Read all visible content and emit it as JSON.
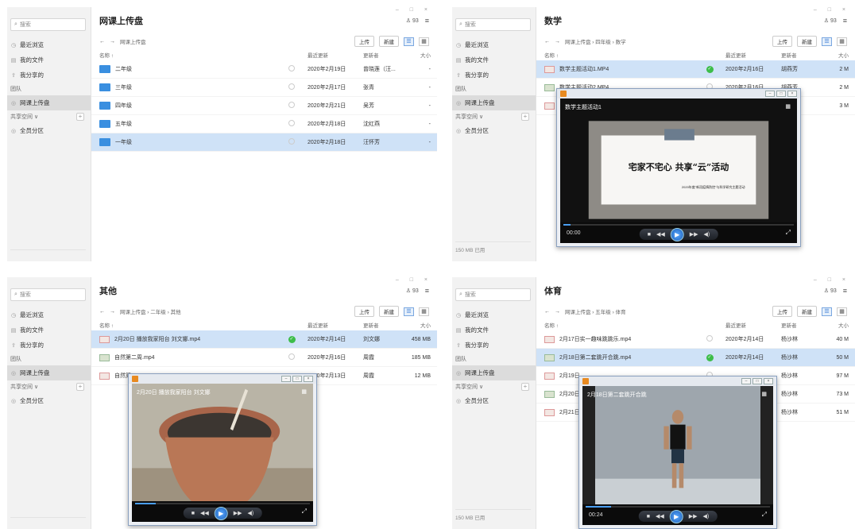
{
  "panels": [
    {
      "sidebar": {
        "search": "搜索",
        "recent": "最近浏览",
        "my_files": "我的文件",
        "my_shared": "我分享的",
        "team_section": "团队",
        "course_upload": "网课上传盘",
        "share_space": "共享空间 ∨",
        "all_staff": "全员分区",
        "quota": ""
      },
      "main": {
        "title": "网课上传盘",
        "user_count": "93",
        "breadcrumb": [
          "网课上传盘"
        ],
        "upload": "上传",
        "new": "新建",
        "columns": {
          "name": "名称 ↑",
          "date": "最近更新",
          "by": "更新者",
          "size": "大小"
        },
        "rows": [
          {
            "name": "二年级",
            "date": "2020年2月19日",
            "by": "曾晓莲（汪...",
            "size": "-",
            "status": "idle",
            "selected": false
          },
          {
            "name": "三年级",
            "date": "2020年2月17日",
            "by": "张青",
            "size": "-",
            "status": "idle",
            "selected": false
          },
          {
            "name": "四年级",
            "date": "2020年2月21日",
            "by": "吴芳",
            "size": "-",
            "status": "idle",
            "selected": false
          },
          {
            "name": "五年级",
            "date": "2020年2月18日",
            "by": "沈红燕",
            "size": "-",
            "status": "idle",
            "selected": false
          },
          {
            "name": "一年级",
            "date": "2020年2月18日",
            "by": "汪怀芳",
            "size": "-",
            "status": "idle",
            "selected": true
          }
        ]
      }
    },
    {
      "sidebar": {
        "search": "搜索",
        "recent": "最近浏览",
        "my_files": "我的文件",
        "my_shared": "我分享的",
        "team_section": "团队",
        "course_upload": "网课上传盘",
        "share_space": "共享空间 ∨",
        "all_staff": "全员分区",
        "quota": "150 MB 已用"
      },
      "main": {
        "title": "数学",
        "user_count": "93",
        "breadcrumb": [
          "网课上传盘",
          "四年级",
          "数学"
        ],
        "upload": "上传",
        "new": "新建",
        "columns": {
          "name": "名称 ↑",
          "date": "最近更新",
          "by": "更新者",
          "size": "大小"
        },
        "rows": [
          {
            "name": "数学主题活动1.MP4",
            "date": "2020年2月16日",
            "by": "胡燕芳",
            "size": "2 M",
            "status": "ok",
            "selected": true
          },
          {
            "name": "数学主题活动2.MP4",
            "date": "2020年2月16日",
            "by": "胡燕芳",
            "size": "2 M",
            "status": "idle",
            "selected": false
          },
          {
            "name": "数",
            "date": "",
            "by": "",
            "size": "3 M",
            "status": "",
            "selected": false
          }
        ]
      },
      "player": {
        "title": "数学主题活动1",
        "slide_main": "宅家不宅心  共享“云”活动",
        "slide_sub": "2020年度“新冠疫情防控”与科学研究主题活动",
        "time": "00:00",
        "progress": 0.03
      }
    },
    {
      "sidebar": {
        "search": "搜索",
        "recent": "最近浏览",
        "my_files": "我的文件",
        "my_shared": "我分享的",
        "team_section": "团队",
        "course_upload": "网课上传盘",
        "share_space": "共享空间 ∨",
        "all_staff": "全员分区",
        "quota": ""
      },
      "main": {
        "title": "其他",
        "user_count": "93",
        "breadcrumb": [
          "网课上传盘",
          "二年级",
          "其他"
        ],
        "upload": "上传",
        "new": "新建",
        "columns": {
          "name": "名称 ↑",
          "date": "最近更新",
          "by": "更新者",
          "size": "大小"
        },
        "rows": [
          {
            "name": "2月20日 播放我家阳台 刘文娜.mp4",
            "date": "2020年2月14日",
            "by": "刘文娜",
            "size": "458 MB",
            "status": "ok",
            "selected": true
          },
          {
            "name": "自然第二周.mp4",
            "date": "2020年2月16日",
            "by": "周霞",
            "size": "185 MB",
            "status": "idle",
            "selected": false
          },
          {
            "name": "自然第...",
            "date": "2020年2月13日",
            "by": "周霞",
            "size": "12 MB",
            "status": "",
            "selected": false
          }
        ]
      },
      "player": {
        "title": "2月20日 播放我家阳台 刘文娜",
        "time": "",
        "progress": 0.12
      }
    },
    {
      "sidebar": {
        "search": "搜索",
        "recent": "最近浏览",
        "my_files": "我的文件",
        "my_shared": "我分享的",
        "team_section": "团队",
        "course_upload": "网课上传盘",
        "share_space": "共享空间 ∨",
        "all_staff": "全员分区",
        "quota": "150 MB 已用"
      },
      "main": {
        "title": "体育",
        "user_count": "93",
        "breadcrumb": [
          "网课上传盘",
          "五年级",
          "体育"
        ],
        "upload": "上传",
        "new": "新建",
        "columns": {
          "name": "名称 ↑",
          "date": "最近更新",
          "by": "更新者",
          "size": "大小"
        },
        "rows": [
          {
            "name": "2月17日实一趣味跳跳乐.mp4",
            "date": "2020年2月14日",
            "by": "杨沙林",
            "size": "40 M",
            "status": "idle",
            "selected": false
          },
          {
            "name": "2月18日第二套跳开合跳.mp4",
            "date": "2020年2月14日",
            "by": "杨沙林",
            "size": "50 M",
            "status": "ok",
            "selected": true
          },
          {
            "name": "2月19日...",
            "date": "",
            "by": "杨沙林",
            "size": "97 M",
            "status": "idle",
            "selected": false
          },
          {
            "name": "2月20日",
            "date": "",
            "by": "杨沙林",
            "size": "73 M",
            "status": "",
            "selected": false
          },
          {
            "name": "2月21日",
            "date": "",
            "by": "杨沙林",
            "size": "51 M",
            "status": "",
            "selected": false
          }
        ]
      },
      "player": {
        "title": "2月18日第二套跳开合跳",
        "time": "00:24",
        "progress": 0.14
      }
    }
  ]
}
